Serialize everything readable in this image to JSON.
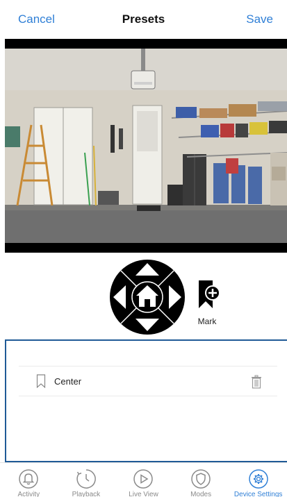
{
  "header": {
    "cancel_label": "Cancel",
    "title": "Presets",
    "save_label": "Save"
  },
  "camera": {
    "feed": "garage-camera-feed"
  },
  "controls": {
    "mark_label": "Mark"
  },
  "presets": [
    {
      "name": "Center"
    }
  ],
  "tabbar": {
    "items": [
      {
        "label": "Activity",
        "icon": "bell-icon",
        "active": false
      },
      {
        "label": "Playback",
        "icon": "clock-icon",
        "active": false
      },
      {
        "label": "Live View",
        "icon": "play-icon",
        "active": false
      },
      {
        "label": "Modes",
        "icon": "shield-icon",
        "active": false
      },
      {
        "label": "Device Settings",
        "icon": "gear-icon",
        "active": true
      }
    ]
  },
  "colors": {
    "accent": "#2f7fd6",
    "panel_border": "#1f5a96"
  }
}
